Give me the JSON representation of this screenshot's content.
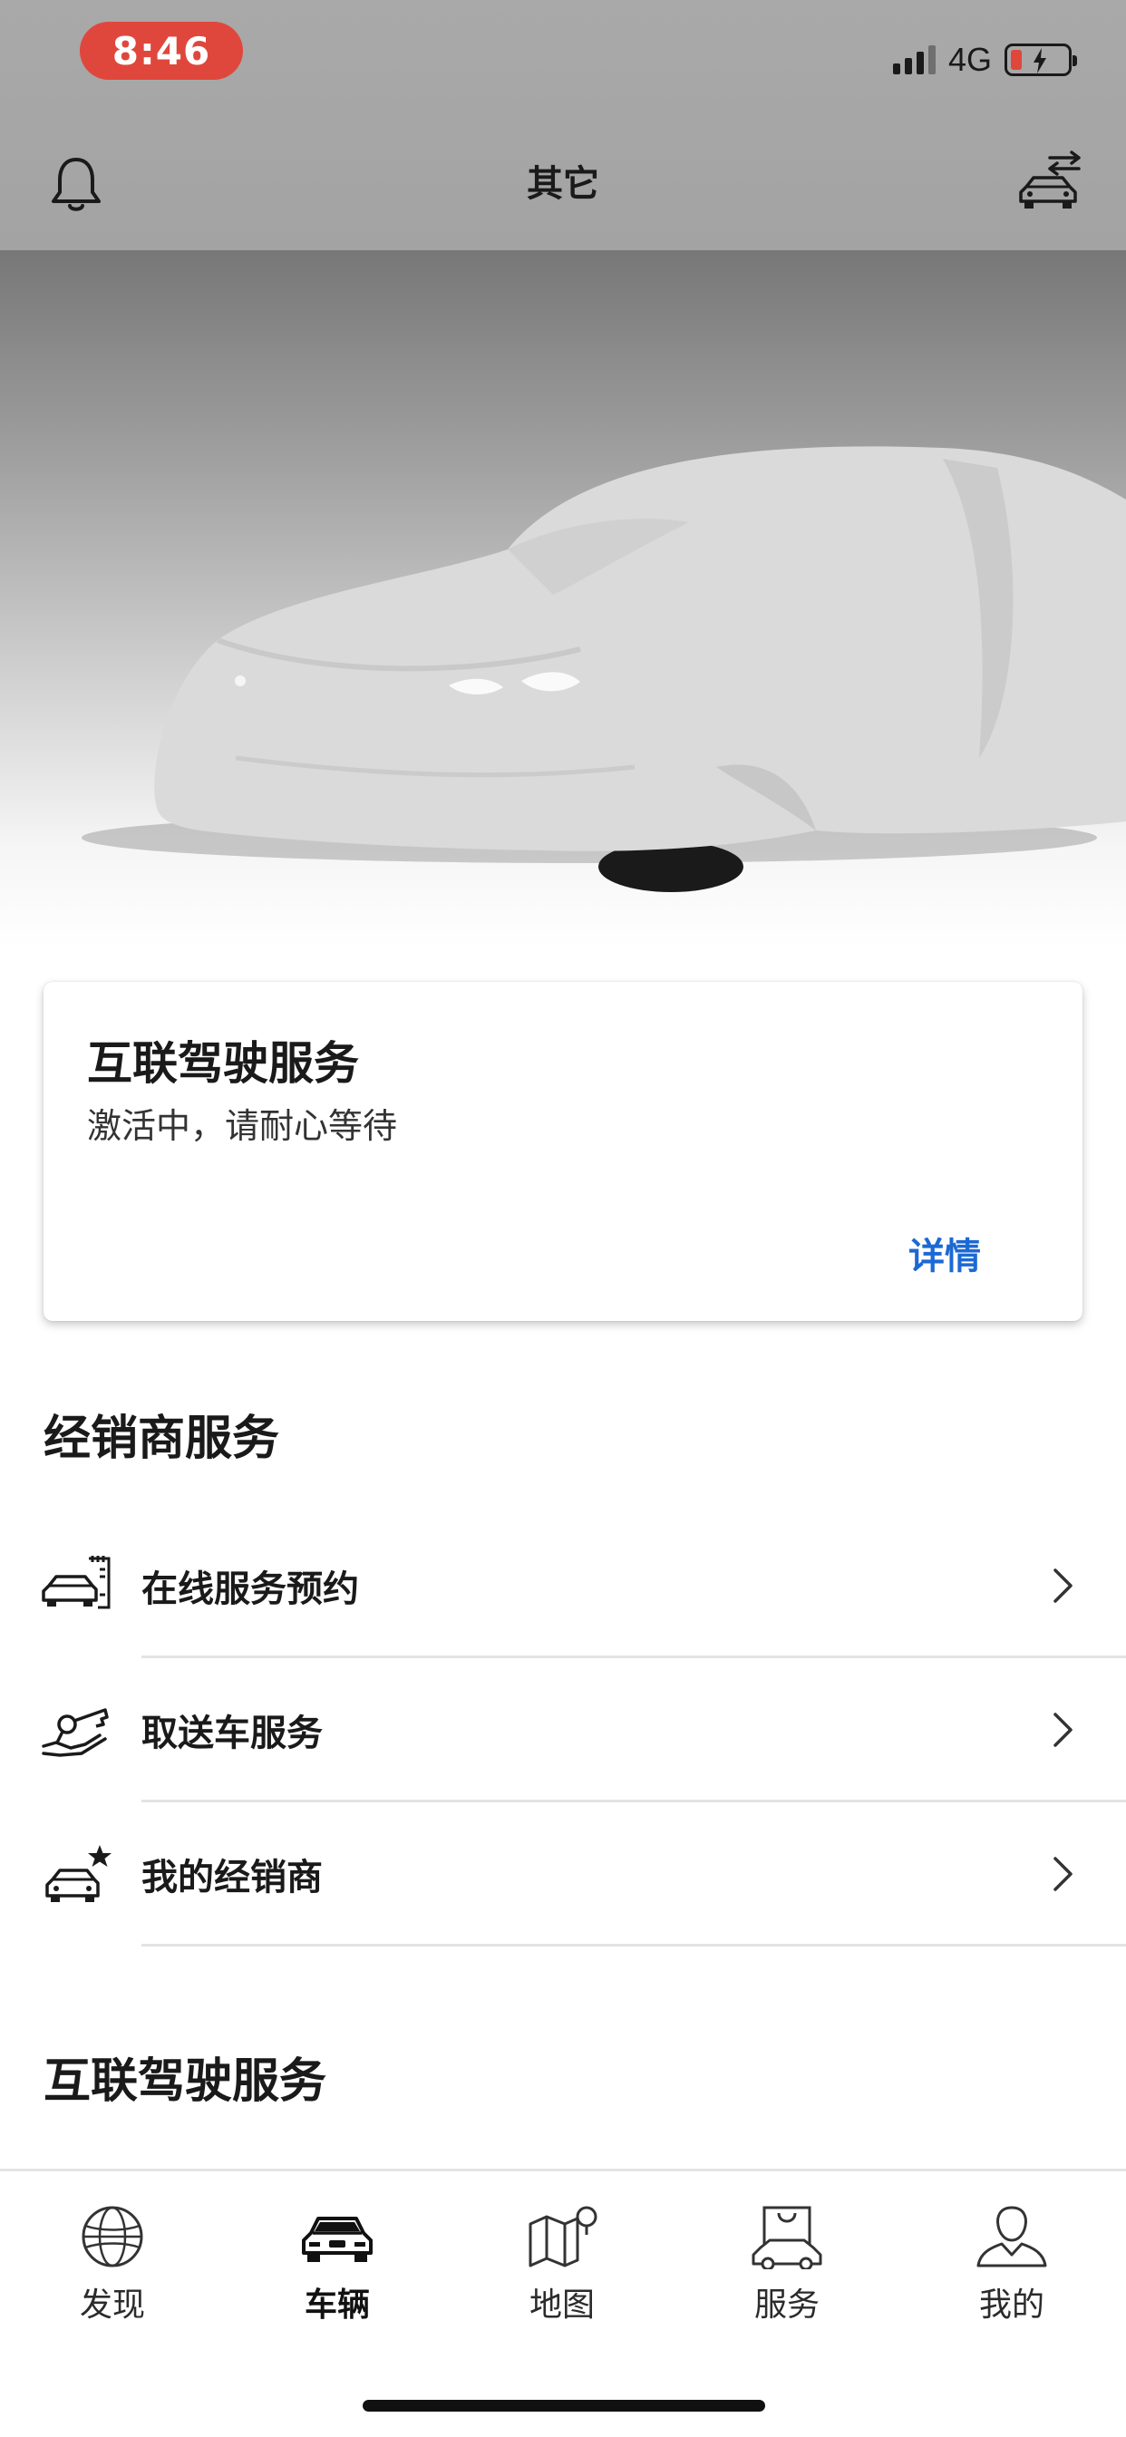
{
  "status_bar": {
    "time": "8:46",
    "network": "4G",
    "battery_color": "#e0473c"
  },
  "header": {
    "title": "其它",
    "left_icon": "bell-icon",
    "right_icon": "car-switch-icon"
  },
  "status_card": {
    "title": "互联驾驶服务",
    "subtitle": "激活中，请耐心等待",
    "link_label": "详情",
    "link_color": "#1c69d4"
  },
  "dealer_section": {
    "title": "经销商服务",
    "items": [
      {
        "label": "在线服务预约",
        "icon": "service-appointment-icon"
      },
      {
        "label": "取送车服务",
        "icon": "pickup-delivery-icon"
      },
      {
        "label": "我的经销商",
        "icon": "my-dealer-icon"
      }
    ]
  },
  "connected_section": {
    "title": "互联驾驶服务"
  },
  "tabbar": {
    "tabs": [
      {
        "label": "发现",
        "icon": "globe-icon"
      },
      {
        "label": "车辆",
        "icon": "car-icon",
        "active": true
      },
      {
        "label": "地图",
        "icon": "map-icon"
      },
      {
        "label": "服务",
        "icon": "shopping-bag-icon"
      },
      {
        "label": "我的",
        "icon": "person-icon"
      }
    ]
  }
}
